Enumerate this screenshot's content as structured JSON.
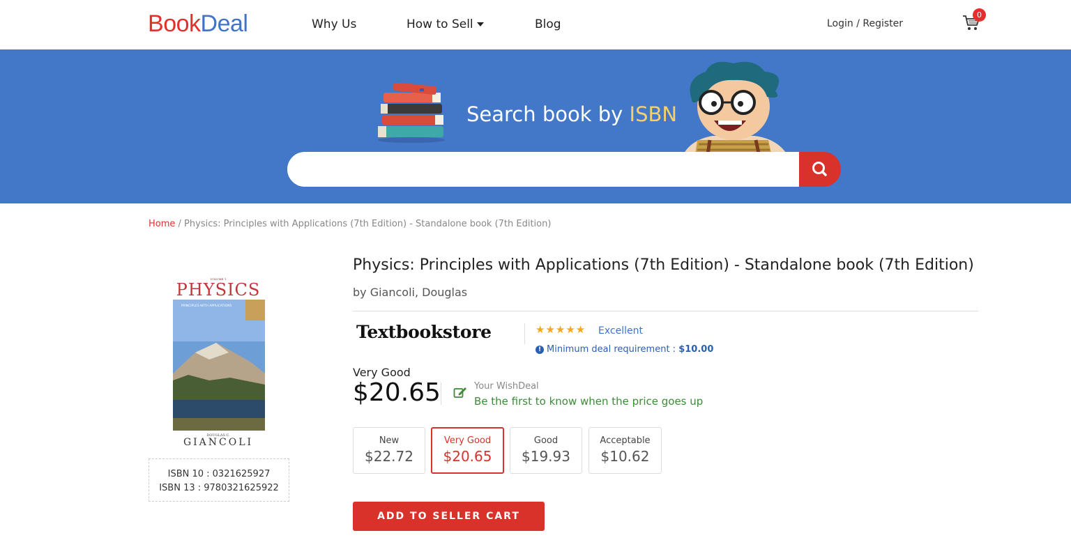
{
  "header": {
    "logo_prefix": "B",
    "logo_book": "ook",
    "logo_deal": "Deal",
    "nav": {
      "why_us": "Why Us",
      "how_to_sell": "How to Sell",
      "blog": "Blog"
    },
    "login": "Login",
    "register": "Register",
    "login_sep": " / ",
    "cart_count": "0"
  },
  "hero": {
    "title_prefix": "Search book by ",
    "title_highlight": "ISBN",
    "search_placeholder": "",
    "search_value": ""
  },
  "breadcrumb": {
    "home": "Home",
    "sep": " / ",
    "current": "Physics: Principles with Applications (7th Edition) - Standalone book (7th Edition)"
  },
  "book": {
    "cover_volume": "VOLUME 1",
    "cover_title": "PHYSICS",
    "cover_subtitle": "PRINCIPLES WITH APPLICATIONS",
    "cover_author_small": "DOUGLAS C.",
    "cover_author": "GIANCOLI",
    "isbn10_label": "ISBN 10 : 0321625927",
    "isbn13_label": "ISBN 13 : 9780321625922",
    "title": "Physics: Principles with Applications (7th Edition) - Standalone book (7th Edition)",
    "author": "by Giancoli, Douglas"
  },
  "seller": {
    "name": "Textbookstore",
    "stars": "★★★★★",
    "rating": "Excellent",
    "min_deal_label": "Minimum deal requirement : ",
    "min_deal_value": "$10.00"
  },
  "offer": {
    "condition": "Very Good",
    "price": "$20.65",
    "wish_title": "Your WishDeal",
    "wish_text": "Be the first to know when the price goes up"
  },
  "conditions": [
    {
      "name": "New",
      "price": "$22.72"
    },
    {
      "name": "Very Good",
      "price": "$20.65"
    },
    {
      "name": "Good",
      "price": "$19.93"
    },
    {
      "name": "Acceptable",
      "price": "$10.62"
    }
  ],
  "colors": {
    "brand_red": "#d9322a",
    "brand_blue": "#4377c7",
    "highlight_yellow": "#f6d06a",
    "wish_green": "#3d8b38"
  },
  "add_button": "ADD TO SELLER CART"
}
